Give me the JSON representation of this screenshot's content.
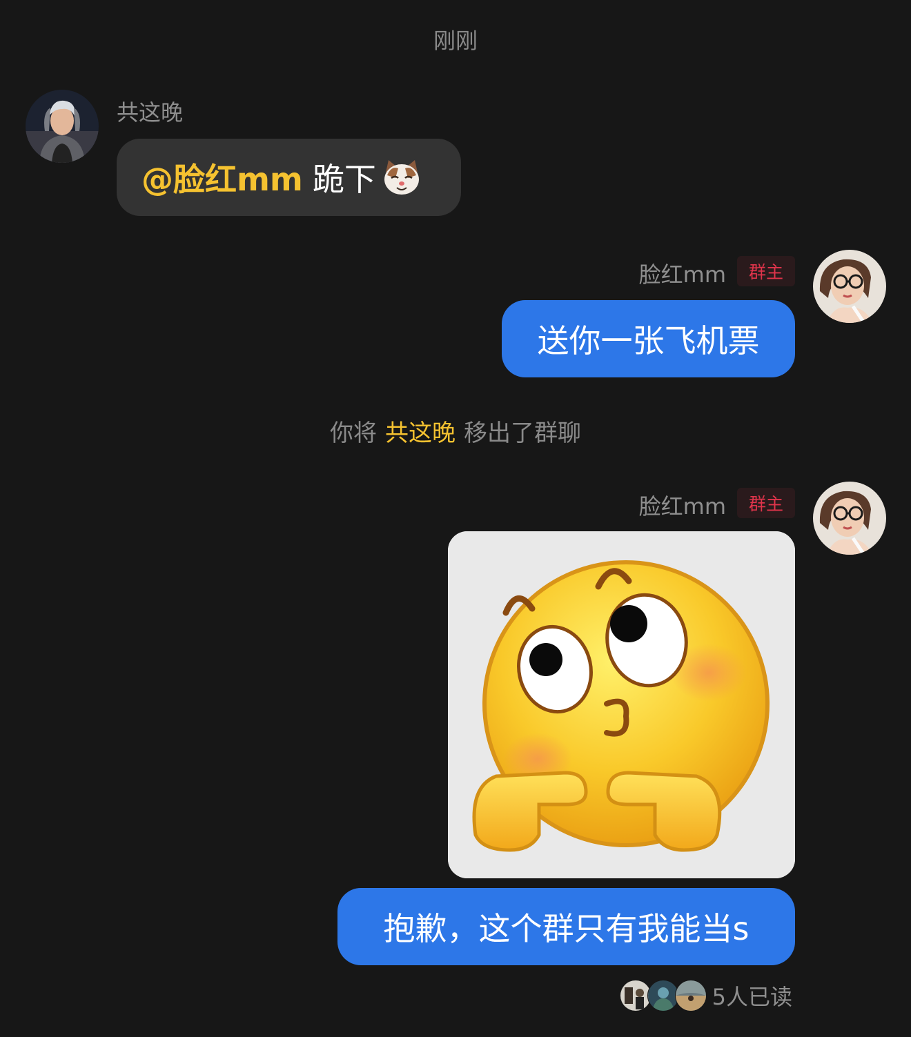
{
  "timestamp": "刚刚",
  "messages": [
    {
      "sender": "共这晚",
      "mention": "@脸红mm",
      "text": "跪下",
      "emoji": "cat-face"
    },
    {
      "sender": "脸红mm",
      "badge": "群主",
      "text": "送你一张飞机票"
    },
    {
      "sender": "脸红mm",
      "badge": "群主",
      "sticker": "blushing-kiss-face",
      "text": "抱歉，这个群只有我能当s"
    }
  ],
  "system_note": {
    "prefix": "你将",
    "name": "共这晚",
    "suffix": "移出了群聊"
  },
  "read_receipt": {
    "text": "5人已读"
  },
  "colors": {
    "background": "#171717",
    "outgoing_bubble": "#2d77e8",
    "incoming_bubble": "#333333",
    "mention": "#f5c230",
    "badge_text": "#e0344b"
  }
}
